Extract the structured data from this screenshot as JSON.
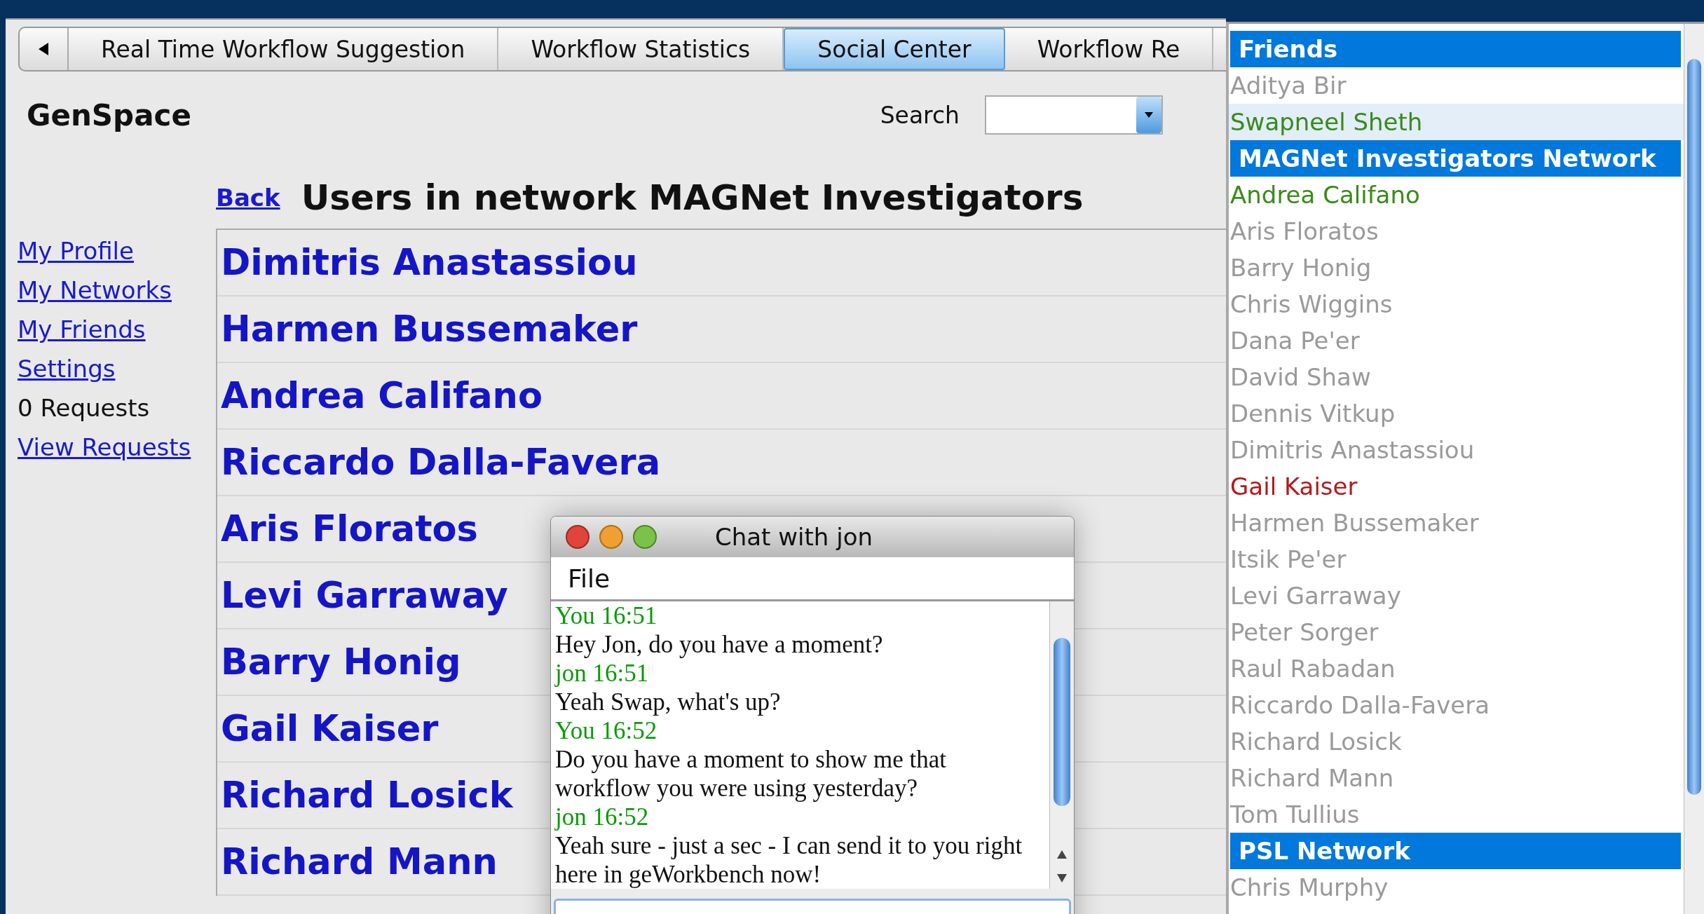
{
  "tabs": [
    {
      "label": "Real Time Workflow Suggestion",
      "selected": false
    },
    {
      "label": "Workflow Statistics",
      "selected": false
    },
    {
      "label": "Social Center",
      "selected": true
    },
    {
      "label": "Workflow Re",
      "selected": false
    }
  ],
  "app_title": "GenSpace",
  "search": {
    "label": "Search"
  },
  "sidebar": {
    "items": [
      {
        "label": "My Profile",
        "kind": "link"
      },
      {
        "label": "My Networks",
        "kind": "link"
      },
      {
        "label": "My Friends",
        "kind": "link"
      },
      {
        "label": "Settings",
        "kind": "link"
      },
      {
        "label": "0 Requests",
        "kind": "text"
      },
      {
        "label": "View Requests",
        "kind": "link"
      }
    ]
  },
  "back_link": "Back",
  "heading": "Users in network MAGNet Investigators",
  "users": [
    "Dimitris Anastassiou",
    "Harmen Bussemaker",
    "Andrea Califano",
    "Riccardo Dalla-Favera",
    "Aris Floratos",
    "Levi Garraway",
    "Barry Honig",
    "Gail Kaiser",
    "Richard Losick",
    "Richard Mann"
  ],
  "chat": {
    "title": "Chat with jon",
    "menu": [
      "File"
    ],
    "messages": [
      {
        "kind": "header",
        "text": "You 16:51"
      },
      {
        "kind": "text",
        "text": "Hey Jon, do you have a moment?"
      },
      {
        "kind": "header",
        "text": "jon 16:51"
      },
      {
        "kind": "text",
        "text": "Yeah Swap, what's up?"
      },
      {
        "kind": "header",
        "text": "You 16:52"
      },
      {
        "kind": "text",
        "text": "Do you have a moment to show me that workflow you were using yesterday?"
      },
      {
        "kind": "header",
        "text": "jon 16:52"
      },
      {
        "kind": "text",
        "text": "Yeah sure - just a sec - I can send it to you right here in geWorkbench now!"
      }
    ]
  },
  "roster": {
    "groups": [
      {
        "title": "Friends",
        "members": [
          {
            "name": "Aditya Bir",
            "color": "#9a9a9a",
            "selected": false
          },
          {
            "name": "Swapneel Sheth",
            "color": "#3a8a1a",
            "selected": true
          }
        ]
      },
      {
        "title": "MAGNet Investigators Network",
        "members": [
          {
            "name": "Andrea Califano",
            "color": "#3a8a1a",
            "selected": false
          },
          {
            "name": "Aris Floratos",
            "color": "#9a9a9a",
            "selected": false
          },
          {
            "name": "Barry Honig",
            "color": "#9a9a9a",
            "selected": false
          },
          {
            "name": "Chris Wiggins",
            "color": "#9a9a9a",
            "selected": false
          },
          {
            "name": "Dana Pe'er",
            "color": "#9a9a9a",
            "selected": false
          },
          {
            "name": "David Shaw",
            "color": "#9a9a9a",
            "selected": false
          },
          {
            "name": "Dennis Vitkup",
            "color": "#9a9a9a",
            "selected": false
          },
          {
            "name": "Dimitris Anastassiou",
            "color": "#9a9a9a",
            "selected": false
          },
          {
            "name": "Gail Kaiser",
            "color": "#b01c1c",
            "selected": false
          },
          {
            "name": "Harmen Bussemaker",
            "color": "#9a9a9a",
            "selected": false
          },
          {
            "name": "Itsik Pe'er",
            "color": "#9a9a9a",
            "selected": false
          },
          {
            "name": "Levi Garraway",
            "color": "#9a9a9a",
            "selected": false
          },
          {
            "name": "Peter Sorger",
            "color": "#9a9a9a",
            "selected": false
          },
          {
            "name": "Raul Rabadan",
            "color": "#9a9a9a",
            "selected": false
          },
          {
            "name": "Riccardo Dalla-Favera",
            "color": "#9a9a9a",
            "selected": false
          },
          {
            "name": "Richard Losick",
            "color": "#9a9a9a",
            "selected": false
          },
          {
            "name": "Richard Mann",
            "color": "#9a9a9a",
            "selected": false
          },
          {
            "name": "Tom Tullius",
            "color": "#9a9a9a",
            "selected": false
          }
        ]
      },
      {
        "title": "PSL Network",
        "members": [
          {
            "name": "Chris Murphy",
            "color": "#9a9a9a",
            "selected": false
          }
        ]
      }
    ]
  }
}
